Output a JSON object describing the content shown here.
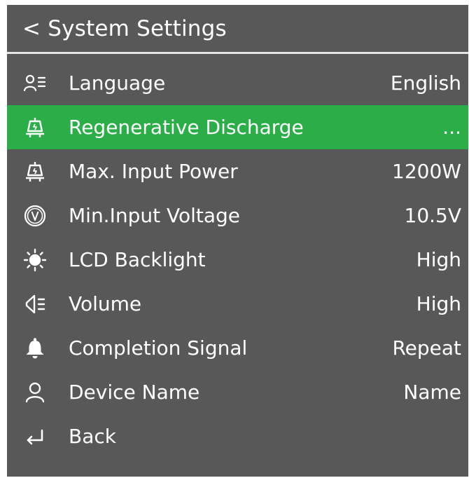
{
  "header": {
    "title": "< System Settings"
  },
  "colors": {
    "background": "#585858",
    "accent": "#2bad47",
    "text": "#ffffff"
  },
  "menu": [
    {
      "icon": "language-icon",
      "label": "Language",
      "value": "English",
      "selected": false
    },
    {
      "icon": "plug-icon",
      "label": "Regenerative Discharge",
      "value": "...",
      "selected": true
    },
    {
      "icon": "plug-icon",
      "label": "Max. Input Power",
      "value": "1200W",
      "selected": false
    },
    {
      "icon": "voltage-icon",
      "label": "Min.Input Voltage",
      "value": "10.5V",
      "selected": false
    },
    {
      "icon": "brightness-icon",
      "label": "LCD Backlight",
      "value": "High",
      "selected": false
    },
    {
      "icon": "speaker-icon",
      "label": "Volume",
      "value": "High",
      "selected": false
    },
    {
      "icon": "bell-icon",
      "label": "Completion Signal",
      "value": "Repeat",
      "selected": false
    },
    {
      "icon": "user-icon",
      "label": "Device Name",
      "value": "Name",
      "selected": false
    },
    {
      "icon": "return-icon",
      "label": "Back",
      "value": "",
      "selected": false
    }
  ]
}
